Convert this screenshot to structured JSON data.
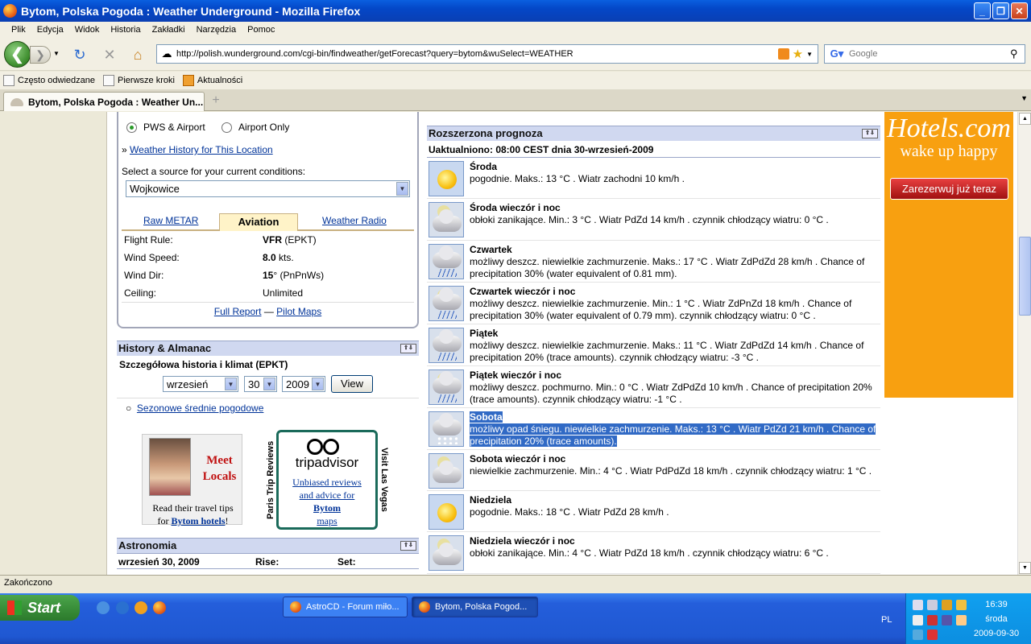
{
  "window": {
    "title": "Bytom, Polska Pogoda : Weather Underground - Mozilla Firefox",
    "controls": [
      "_",
      "❐",
      "✕"
    ]
  },
  "menu": [
    "Plik",
    "Edycja",
    "Widok",
    "Historia",
    "Zakładki",
    "Narzędzia",
    "Pomoc"
  ],
  "nav": {
    "url": "http://polish.wunderground.com/cgi-bin/findweather/getForecast?query=bytom&wuSelect=WEATHER",
    "search_placeholder": "Google"
  },
  "bookmarks": [
    "Często odwiedzane",
    "Pierwsze kroki",
    "Aktualności"
  ],
  "tab": {
    "title": "Bytom, Polska Pogoda : Weather Un..."
  },
  "left": {
    "radio_pws": "PWS & Airport",
    "radio_airport": "Airport Only",
    "history_prefix": "»",
    "history_link": "Weather History for This Location",
    "source_label": "Select a source for your current conditions:",
    "source_value": "Wojkowice",
    "tabs": [
      "Raw METAR",
      "Aviation",
      "Weather Radio"
    ],
    "aviation": [
      {
        "label": "Flight Rule:",
        "bold": "VFR",
        "rest": " (EPKT)"
      },
      {
        "label": "Wind Speed:",
        "bold": "8.0",
        "rest": " kts."
      },
      {
        "label": "Wind Dir:",
        "bold": "15",
        "rest": "° (PnPnWs)"
      },
      {
        "label": "Ceiling:",
        "bold": "",
        "rest": "Unlimited"
      }
    ],
    "full_report": "Full Report",
    "dash": "—",
    "pilot_maps": "Pilot Maps",
    "history_title": "History & Almanac",
    "history_sub": "Szczegółowa historia i klimat (EPKT)",
    "month": "wrzesień",
    "day": "30",
    "year": "2009",
    "view_btn": "View",
    "seasonal_link": "Sezonowe średnie pogodowe",
    "meet": {
      "line1": "Meet",
      "line2": "Locals",
      "tips1": "Read their travel tips",
      "tips2_pre": "for ",
      "tips2_link": "Bytom hotels",
      "tips2_post": "!"
    },
    "trip": {
      "left": "Paris Trip Reviews",
      "right": "Visit Las Vegas",
      "name": "tripadvisor",
      "l1": "Unbiased reviews",
      "l2": "and advice for",
      "l3": "Bytom",
      "l4": "maps"
    },
    "astro_title": "Astronomia",
    "astro_date": "wrzesień 30, 2009",
    "astro_rise": "Rise:",
    "astro_set": "Set:",
    "toggle": "⇧⇩"
  },
  "forecast": {
    "title": "Rozszerzona prognoza",
    "updated": "Uaktualniono: 08:00 CEST dnia 30-wrzesień-2009",
    "rows": [
      {
        "icon": "sunny-icon",
        "day": "Środa",
        "text": "pogodnie. Maks.: 13 °C . Wiatr zachodni 10 km/h ."
      },
      {
        "icon": "cloudy-night-icon",
        "day": "Środa wieczór i noc",
        "text": "obłoki zanikające. Min.: 3 °C . Wiatr PdZd 14 km/h . czynnik chłodzący wiatru: 0 °C ."
      },
      {
        "icon": "rain-icon",
        "day": "Czwartek",
        "text": "możliwy deszcz. niewielkie zachmurzenie. Maks.: 17 °C . Wiatr ZdPdZd 28 km/h . Chance of precipitation 30% (water equivalent of 0.81 mm)."
      },
      {
        "icon": "rain-night-icon",
        "day": "Czwartek wieczór i noc",
        "text": "możliwy deszcz. niewielkie zachmurzenie. Min.: 1 °C . Wiatr ZdPnZd 18 km/h . Chance of precipitation 30% (water equivalent of 0.79 mm). czynnik chłodzący wiatru: 0 °C ."
      },
      {
        "icon": "rain-icon",
        "day": "Piątek",
        "text": "możliwy deszcz. niewielkie zachmurzenie. Maks.: 11 °C . Wiatr ZdPdZd 14 km/h . Chance of precipitation 20% (trace amounts). czynnik chłodzący wiatru: -3 °C ."
      },
      {
        "icon": "rain-night-icon",
        "day": "Piątek wieczór i noc",
        "text": "możliwy deszcz. pochmurno. Min.: 0 °C . Wiatr ZdPdZd 10 km/h . Chance of precipitation 20% (trace amounts). czynnik chłodzący wiatru: -1 °C ."
      },
      {
        "icon": "snow-icon",
        "day": "Sobota",
        "text": "możliwy opad śniegu. niewielkie zachmurzenie. Maks.: 13 °C . Wiatr PdZd 21 km/h . Chance of precipitation 20% (trace amounts).",
        "selected": true
      },
      {
        "icon": "cloudy-night-icon",
        "day": "Sobota wieczór i noc",
        "text": "niewielkie zachmurzenie. Min.: 4 °C . Wiatr PdPdZd 18 km/h . czynnik chłodzący wiatru: 1 °C ."
      },
      {
        "icon": "sunny-icon",
        "day": "Niedziela",
        "text": "pogodnie. Maks.: 18 °C . Wiatr PdZd 28 km/h ."
      },
      {
        "icon": "cloudy-night-icon",
        "day": "Niedziela wieczór i noc",
        "text": "obłoki zanikające. Min.: 4 °C . Wiatr PdZd 18 km/h . czynnik chłodzący wiatru: 6 °C ."
      }
    ]
  },
  "hotels": {
    "logo": "Hotels.com",
    "tagline": "wake up happy",
    "cta": "Zarezerwuj już teraz"
  },
  "status": "Zakończono",
  "taskbar": {
    "start": "Start",
    "tasks": [
      "AstroCD - Forum miło...",
      "Bytom, Polska Pogod..."
    ],
    "lang": "PL",
    "time": "16:39",
    "weekday": "środa",
    "date": "2009-09-30"
  }
}
